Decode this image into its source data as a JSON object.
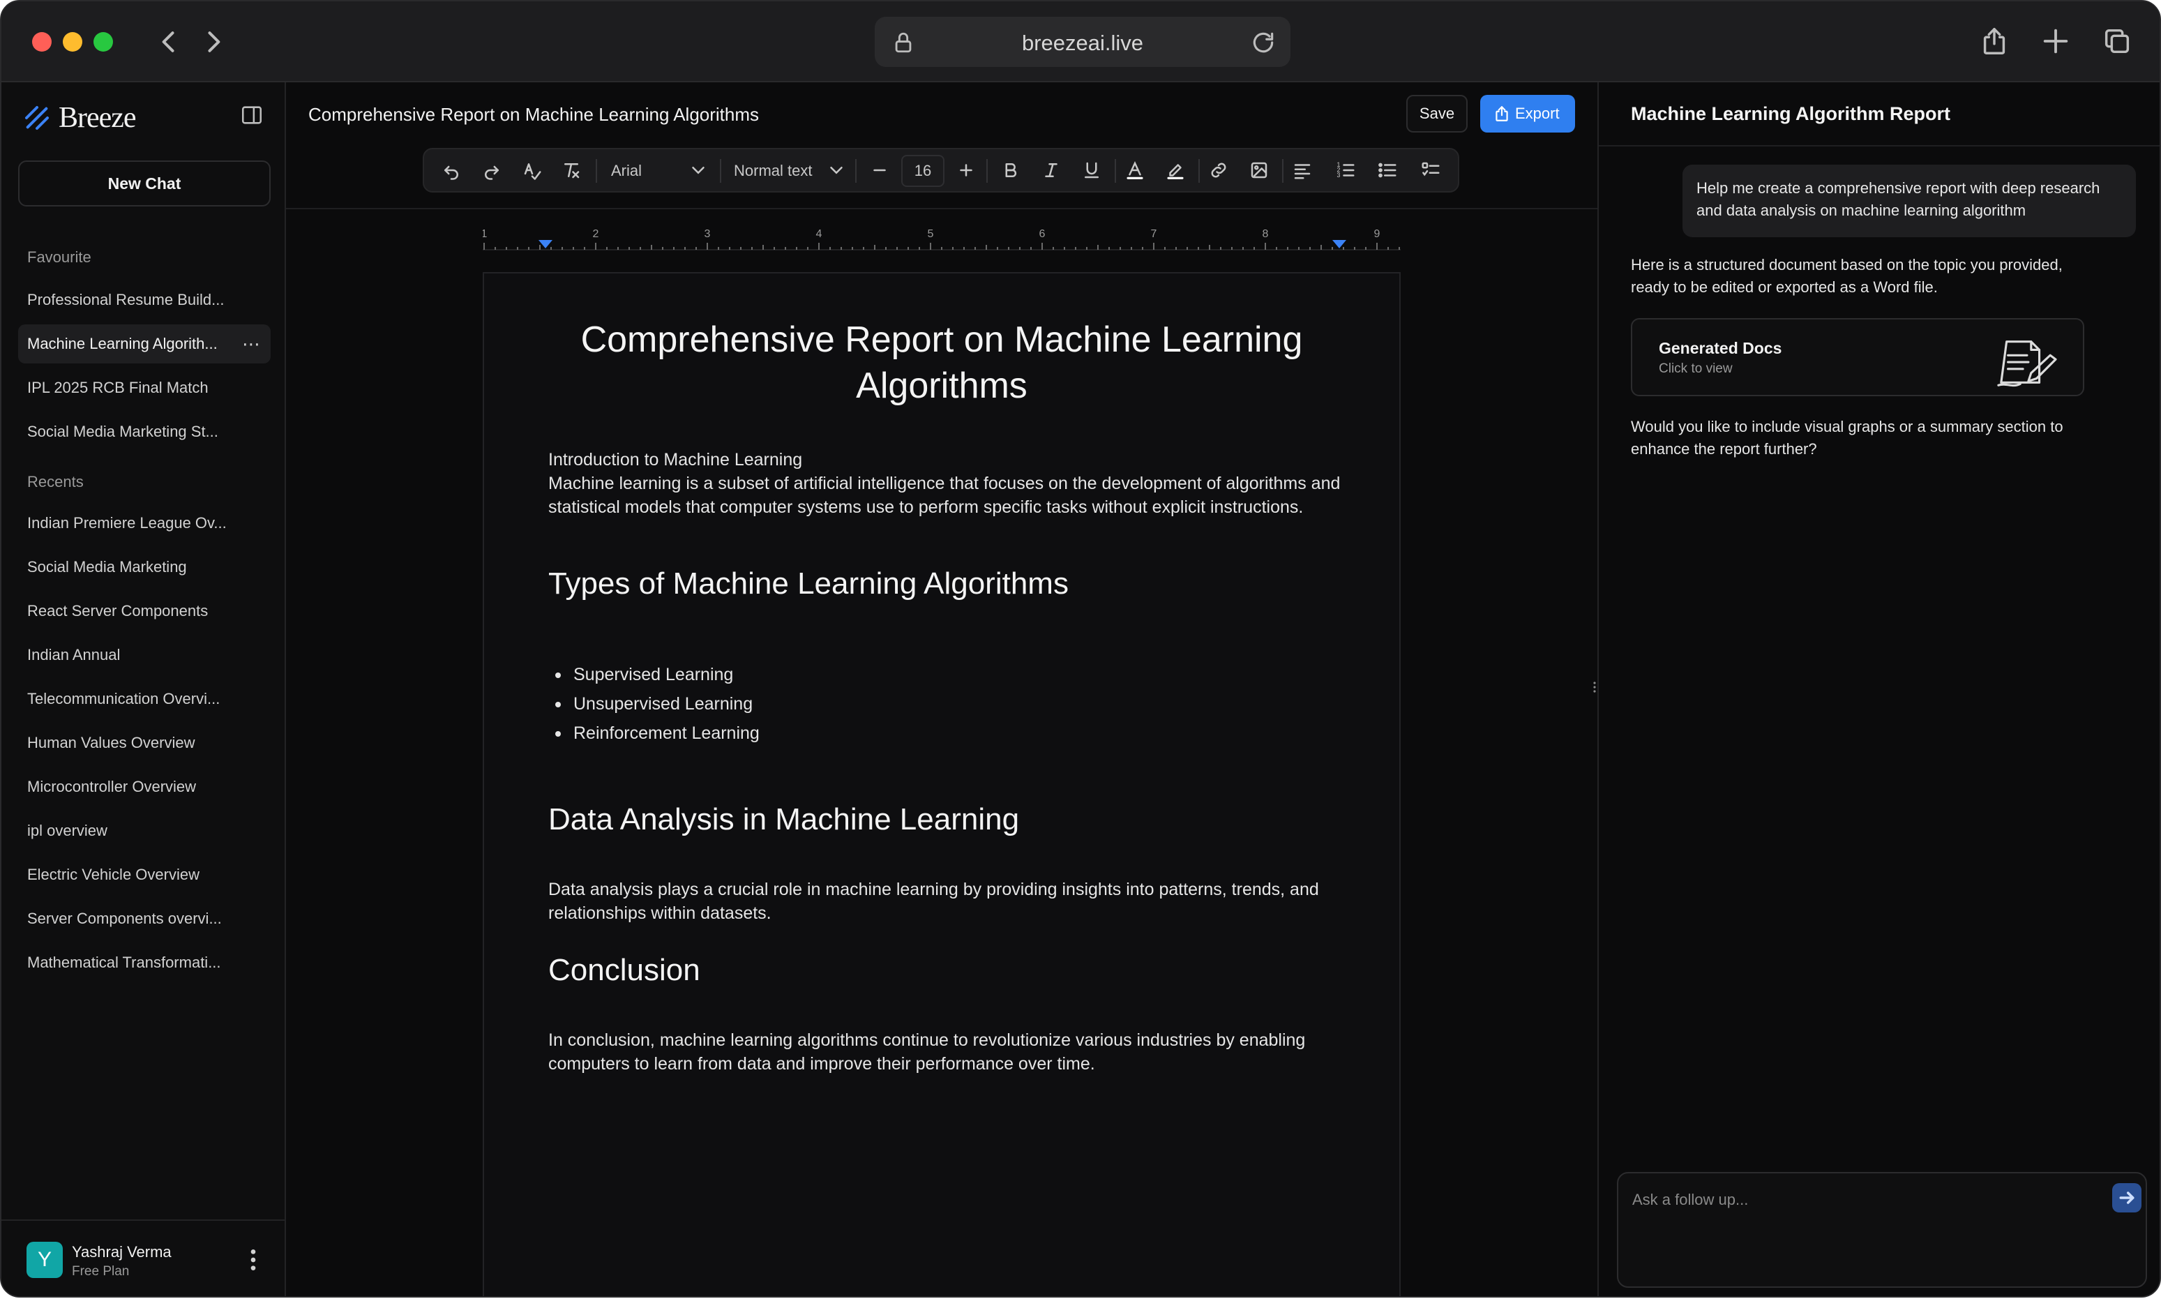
{
  "browser": {
    "url": "breezeai.live"
  },
  "sidebar": {
    "brand": "Breeze",
    "new_chat_label": "New Chat",
    "favourite_label": "Favourite",
    "favourites": [
      {
        "label": "Professional Resume Build..."
      },
      {
        "label": "Machine Learning Algorith...",
        "active": true
      },
      {
        "label": "IPL 2025 RCB Final Match"
      },
      {
        "label": "Social Media Marketing St..."
      }
    ],
    "recents_label": "Recents",
    "recents": [
      {
        "label": "Indian Premiere League Ov..."
      },
      {
        "label": "Social Media Marketing"
      },
      {
        "label": "React Server Components"
      },
      {
        "label": "Indian Annual"
      },
      {
        "label": "Telecommunication Overvi..."
      },
      {
        "label": "Human Values Overview"
      },
      {
        "label": "Microcontroller Overview"
      },
      {
        "label": "ipl overview"
      },
      {
        "label": "Electric Vehicle Overview"
      },
      {
        "label": "Server Components overvi..."
      },
      {
        "label": "Mathematical Transformati..."
      }
    ],
    "item_more_icon": "more-horizontal-icon",
    "user": {
      "initial": "Y",
      "name": "Yashraj Verma",
      "plan": "Free Plan",
      "avatar_color": "#11a6a6"
    }
  },
  "editor": {
    "doc_title": "Comprehensive Report on Machine Learning Algorithms",
    "save_label": "Save",
    "export_label": "Export",
    "accent_color": "#2f7ff0",
    "toolbar": {
      "font_family": "Arial",
      "text_style": "Normal text",
      "font_size": "16"
    },
    "ruler_labels": [
      "1",
      "2",
      "3",
      "4",
      "5",
      "6",
      "7",
      "8",
      "9"
    ],
    "document": {
      "title": "Comprehensive Report on Machine Learning Algorithms",
      "intro_heading": "Introduction to Machine Learning",
      "intro_body": "Machine learning is a subset of artificial intelligence that focuses on the development of algorithms and statistical models that computer systems use to perform specific tasks without explicit instructions.",
      "types_heading": "Types of Machine Learning Algorithms",
      "types_list": [
        "Supervised Learning",
        "Unsupervised Learning",
        "Reinforcement Learning"
      ],
      "data_heading": "Data Analysis in Machine Learning",
      "data_body": "Data analysis plays a crucial role in machine learning by providing insights into patterns, trends, and relationships within datasets.",
      "conclusion_heading": "Conclusion",
      "conclusion_body": "In conclusion, machine learning algorithms continue to revolutionize various industries by enabling computers to learn from data and improve their performance over time."
    }
  },
  "chat": {
    "title": "Machine Learning Algorithm Report",
    "user_message": "Help me create a comprehensive report with deep research and data analysis on machine learning algorithm",
    "ai_message_1": "Here is a structured document based on the topic you provided, ready to be edited or exported as a Word file.",
    "doc_card_title": "Generated Docs",
    "doc_card_sub": "Click to view",
    "ai_message_2": "Would you like to include visual graphs or a summary section to enhance the report further?",
    "input_placeholder": "Ask a follow up..."
  }
}
